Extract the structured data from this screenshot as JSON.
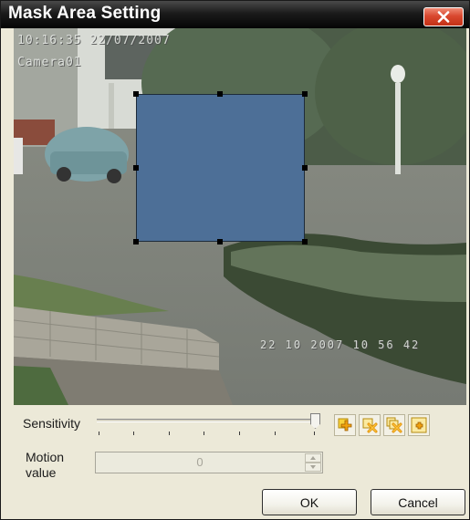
{
  "window": {
    "title": "Mask Area Setting",
    "close_icon": "close-icon"
  },
  "video": {
    "osd_datetime": "10:16:35 22/07/2007",
    "osd_camera": "Camera01",
    "osd_bottom_datetime": "22 10 2007 10 56 42",
    "mask_color": "#4d6f97"
  },
  "controls": {
    "sensitivity_label": "Sensitivity",
    "sensitivity_level": 1.0,
    "motion_label_line1": "Motion",
    "motion_label_line2": "value",
    "motion_value": "0",
    "tools": [
      {
        "icon": "add-area-icon"
      },
      {
        "icon": "delete-area-icon"
      },
      {
        "icon": "clear-all-icon"
      },
      {
        "icon": "full-area-icon"
      }
    ]
  },
  "buttons": {
    "ok": "OK",
    "cancel": "Cancel"
  }
}
